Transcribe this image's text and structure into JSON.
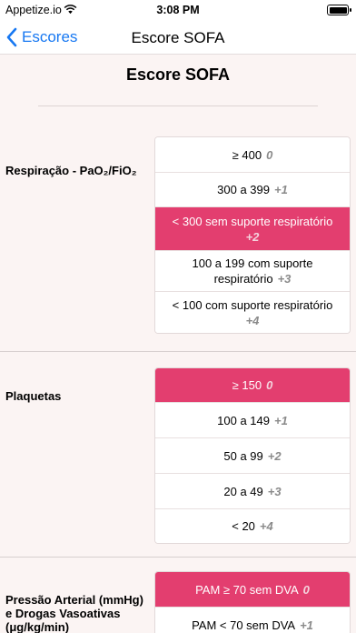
{
  "status_bar": {
    "carrier": "Appetize.io",
    "time": "3:08 PM"
  },
  "nav": {
    "back_label": "Escores",
    "title": "Escore SOFA"
  },
  "page_title": "Escore SOFA",
  "criteria": [
    {
      "label": "Respiração - PaO₂/FiO₂",
      "options": [
        {
          "label": "≥ 400",
          "points": "0",
          "selected": false
        },
        {
          "label": "300 a 399",
          "points": "+1",
          "selected": false
        },
        {
          "label": "< 300 sem suporte respiratório",
          "points": "+2",
          "selected": true
        },
        {
          "label": "100 a 199 com suporte respiratório",
          "points": "+3",
          "selected": false
        },
        {
          "label": "< 100 com suporte respiratório",
          "points": "+4",
          "selected": false
        }
      ]
    },
    {
      "label": "Plaquetas",
      "options": [
        {
          "label": "≥ 150",
          "points": "0",
          "selected": true
        },
        {
          "label": "100 a 149",
          "points": "+1",
          "selected": false
        },
        {
          "label": "50 a 99",
          "points": "+2",
          "selected": false
        },
        {
          "label": "20 a 49",
          "points": "+3",
          "selected": false
        },
        {
          "label": "< 20",
          "points": "+4",
          "selected": false
        }
      ]
    },
    {
      "label": "Pressão Arterial (mmHg) e Drogas Vasoativas (μg/kg/min)",
      "options": [
        {
          "label": "PAM ≥ 70 sem DVA",
          "points": "0",
          "selected": true
        },
        {
          "label": "PAM < 70 sem DVA",
          "points": "+1",
          "selected": false
        }
      ]
    }
  ],
  "colors": {
    "accent": "#e33e6f",
    "link": "#1778f2",
    "background": "#fbf4f3"
  }
}
